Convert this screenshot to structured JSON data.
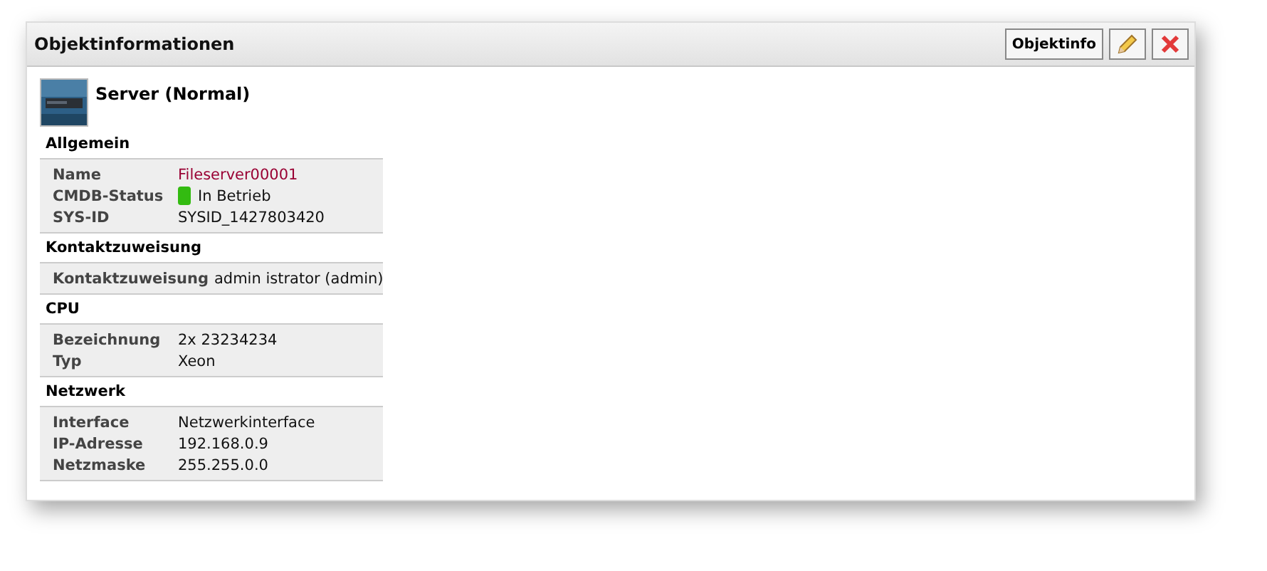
{
  "panel": {
    "title": "Objektinformationen",
    "buttons": [
      {
        "kind": "text",
        "label": "Objektinfo"
      },
      {
        "kind": "edit"
      },
      {
        "kind": "close"
      }
    ]
  },
  "object": {
    "title": "Server (Normal)"
  },
  "sections": [
    {
      "title": "Allgemein",
      "rows": [
        {
          "kind": "link",
          "label": "Name",
          "value": "Fileserver00001"
        },
        {
          "kind": "status",
          "label": "CMDB-Status",
          "value": "In Betrieb",
          "color": "#33bb11"
        },
        {
          "kind": "text",
          "label": "SYS-ID",
          "value": "SYSID_1427803420"
        }
      ]
    },
    {
      "title": "Kontaktzuweisung",
      "rows": [
        {
          "kind": "text",
          "label": "Kontaktzuweisung",
          "value": "admin istrator (admin)"
        }
      ]
    },
    {
      "title": "CPU",
      "rows": [
        {
          "kind": "text",
          "label": "Bezeichnung",
          "value": "2x 23234234"
        },
        {
          "kind": "text",
          "label": "Typ",
          "value": "Xeon"
        }
      ]
    },
    {
      "title": "Netzwerk",
      "rows": [
        {
          "kind": "text",
          "label": "Interface",
          "value": "Netzwerkinterface"
        },
        {
          "kind": "text",
          "label": "IP-Adresse",
          "value": "192.168.0.9"
        },
        {
          "kind": "text",
          "label": "Netzmaske",
          "value": "255.255.0.0"
        }
      ]
    }
  ]
}
